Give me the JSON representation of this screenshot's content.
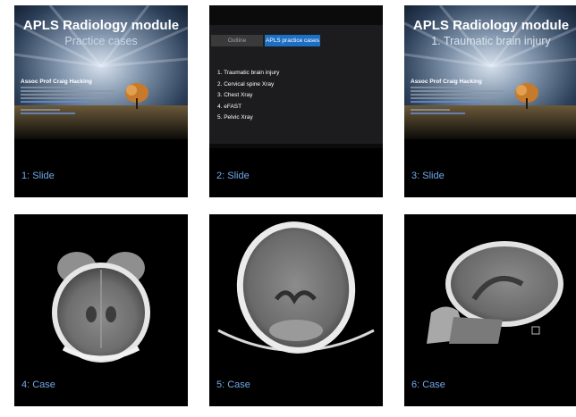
{
  "tiles": [
    {
      "caption": "1: Slide",
      "kind": "title-slide",
      "title": "APLS Radiology module",
      "subtitle": "Practice cases",
      "author": "Assoc Prof Craig Hacking"
    },
    {
      "caption": "2: Slide",
      "kind": "outline-slide",
      "tabs": [
        "Outline",
        "APLS practice cases"
      ],
      "items": [
        "1.  Traumatic brain injury",
        "2.  Cervical spine Xray",
        "3.  Chest Xray",
        "4.  eFAST",
        "5.  Pelvic Xray"
      ]
    },
    {
      "caption": "3: Slide",
      "kind": "title-slide",
      "title": "APLS Radiology module",
      "subtitle": "1. Traumatic brain injury",
      "author": "Assoc Prof Craig Hacking"
    },
    {
      "caption": "4: Case",
      "kind": "ct-coronal"
    },
    {
      "caption": "5: Case",
      "kind": "ct-axial"
    },
    {
      "caption": "6: Case",
      "kind": "ct-sagittal"
    }
  ],
  "colors": {
    "caption": "#6fa8e8",
    "tile_bg": "#000000",
    "active_tab": "#1d6fc4"
  }
}
